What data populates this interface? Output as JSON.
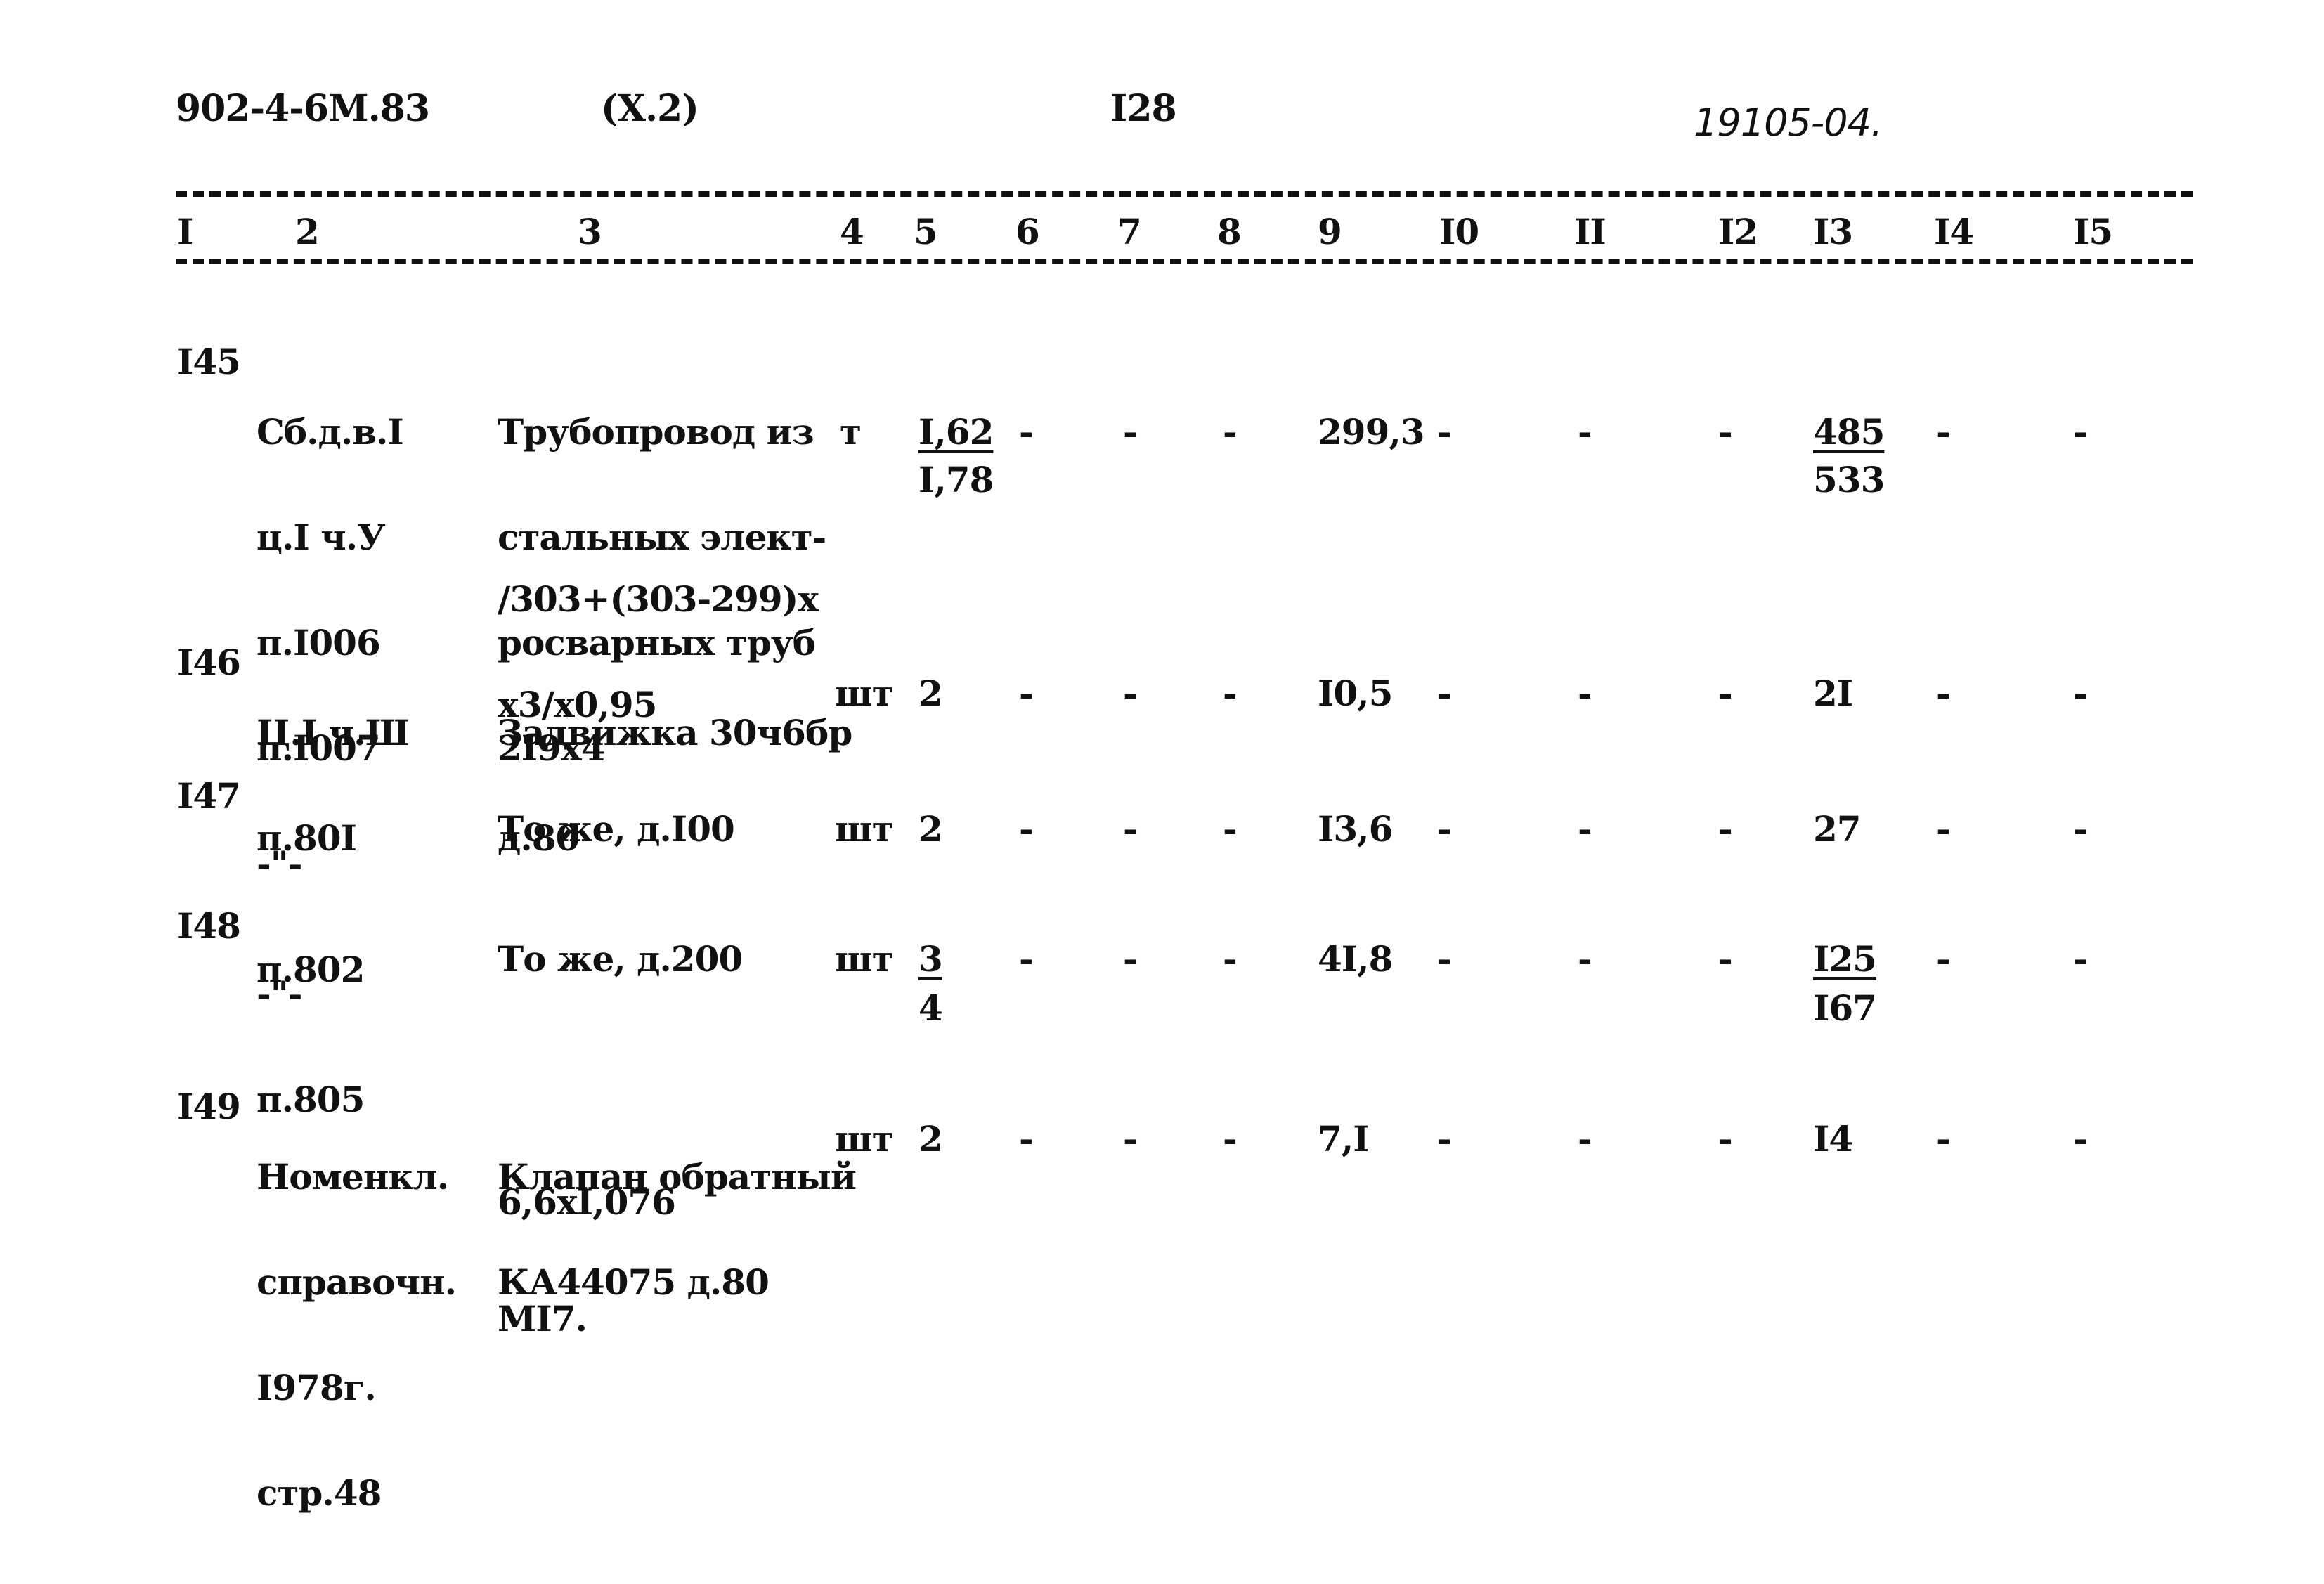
{
  "header": {
    "doc_code": "902-4-6М.83",
    "section": "(X.2)",
    "page_number": "I28",
    "handwritten_ref": "19105-04."
  },
  "columns": [
    "I",
    "2",
    "3",
    "4",
    "5",
    "6",
    "7",
    "8",
    "9",
    "I0",
    "II",
    "I2",
    "I3",
    "I4",
    "I5"
  ],
  "rows": [
    {
      "num": "I45",
      "source": [
        "Сб.д.в.I",
        "ц.I ч.У",
        "п.I006",
        "п.I007"
      ],
      "description": [
        "Трубопровод из",
        "стальных элект-",
        "росварных труб",
        "2I9х4"
      ],
      "formula": [
        "/303+(303-299)х",
        "х3/х0,95"
      ],
      "unit": "т",
      "qty_top": "I,62",
      "qty_bottom": "I,78",
      "c6": "-",
      "c7": "-",
      "c8": "-",
      "c9": "299,3",
      "c10": "-",
      "c11": "-",
      "c12": "-",
      "c13_top": "485",
      "c13_bottom": "533",
      "c14": "-",
      "c15": "-"
    },
    {
      "num": "I46",
      "source": [
        "Ц.I ч.Ш",
        "п.80I"
      ],
      "description": [
        "Задвижка 30ч6бр",
        "д.80"
      ],
      "unit": "шт",
      "qty": "2",
      "c6": "-",
      "c7": "-",
      "c8": "-",
      "c9": "I0,5",
      "c10": "-",
      "c11": "-",
      "c12": "-",
      "c13": "2I",
      "c14": "-",
      "c15": "-"
    },
    {
      "num": "I47",
      "source": [
        "-\"-",
        "п.802"
      ],
      "description": [
        "То же, д.I00"
      ],
      "unit": "шт",
      "qty": "2",
      "c6": "-",
      "c7": "-",
      "c8": "-",
      "c9": "I3,6",
      "c10": "-",
      "c11": "-",
      "c12": "-",
      "c13": "27",
      "c14": "-",
      "c15": "-"
    },
    {
      "num": "I48",
      "source": [
        "-\"-",
        "п.805"
      ],
      "description": [
        "То же, д.200"
      ],
      "unit": "шт",
      "qty_top": "3",
      "qty_bottom": "4",
      "c6": "-",
      "c7": "-",
      "c8": "-",
      "c9": "4I,8",
      "c10": "-",
      "c11": "-",
      "c12": "-",
      "c13_top": "I25",
      "c13_bottom": "I67",
      "c14": "-",
      "c15": "-"
    },
    {
      "num": "I49",
      "source": [
        "Номенкл.",
        "справочн.",
        "I978г.",
        "стр.48"
      ],
      "description": [
        "Клапан обратный",
        "КА44075 д.80"
      ],
      "formula": [
        "6,6хI,076"
      ],
      "unit": "шт",
      "qty": "2",
      "c6": "-",
      "c7": "-",
      "c8": "-",
      "c9": "7,I",
      "c10": "-",
      "c11": "-",
      "c12": "-",
      "c13": "I4",
      "c14": "-",
      "c15": "-"
    }
  ],
  "footer_note": "МI7."
}
